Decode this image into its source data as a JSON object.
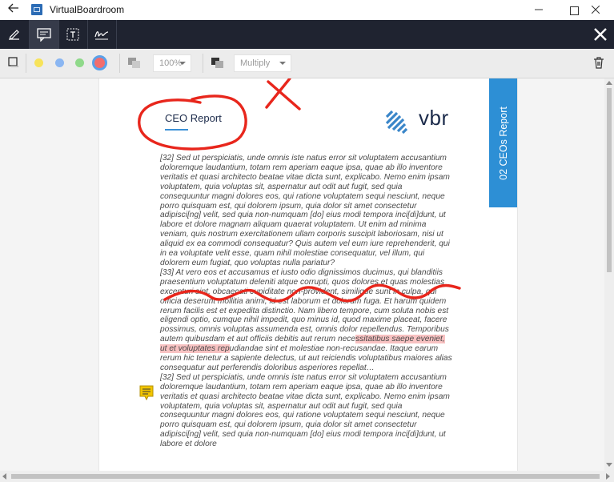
{
  "window": {
    "title": "VirtualBoardroom",
    "back_icon": "back-arrow-icon",
    "app_icon": "vbr-app-icon",
    "minimize": "minimize-icon",
    "maximize": "maximize-icon",
    "close": "close-icon"
  },
  "toolbar": {
    "tools": [
      {
        "name": "pen-tool",
        "icon": "pen-icon"
      },
      {
        "name": "comment-tool",
        "icon": "comment-icon",
        "active": true
      },
      {
        "name": "text-tool",
        "icon": "text-box-icon"
      },
      {
        "name": "signature-tool",
        "icon": "signature-icon"
      }
    ],
    "close_icon": "close-x-icon"
  },
  "options": {
    "shape_icon": "square-outline-icon",
    "colors": [
      "#f7e35a",
      "#8ab6f2",
      "#8fd98a",
      "#f26d6d"
    ],
    "selected_color": "#f26d6d",
    "opacity_icon": "opacity-icon",
    "opacity_value": "100%",
    "blend_icon": "blend-mode-icon",
    "blend_mode": "Multiply",
    "delete_icon": "trash-icon"
  },
  "document": {
    "title": "CEO Report",
    "logo_text": "vbr",
    "side_tab": "02 CEOs Report",
    "paragraphs": [
      "[32] Sed ut perspiciatis, unde omnis iste natus error sit voluptatem accusantium doloremque laudantium, totam rem aperiam eaque ipsa, quae ab illo inventore veritatis et quasi architecto beatae vitae dicta sunt, explicabo. Nemo enim ipsam voluptatem, quia voluptas sit, aspernatur aut odit aut fugit, sed quia consequuntur magni dolores eos, qui ratione voluptatem sequi nesciunt, neque porro quisquam est, qui dolorem ipsum, quia dolor sit amet consectetur adipisci[ng] velit, sed quia non-numquam [do] eius modi tempora inci[di]dunt, ut labore et dolore magnam aliquam quaerat voluptatem. Ut enim ad minima veniam, quis nostrum exercitationem ullam corporis suscipit laboriosam, nisi ut aliquid ex ea commodi consequatur? Quis autem vel eum iure reprehenderit, qui in ea voluptate velit esse, quam nihil molestiae consequatur, vel illum, qui dolorem eum fugiat, quo voluptas nulla pariatur?",
      "[33] At vero eos et accusamus et iusto odio dignissimos ducimus, qui blanditiis praesentium voluptatum deleniti atque corrupti, quos dolores et quas molestias excepturi sint, obcaecati cupiditate non-provident, similique sunt in culpa, qui officia deserunt mollitia animi, id est laborum et dolorum fuga. Et harum quidem rerum facilis est et expedita distinctio. Nam libero tempore, cum soluta nobis est eligendi optio, cumque nihil impedit, quo minus id, quod maxime placeat, facere possimus, omnis voluptas assumenda est, omnis dolor repellendus. Temporibus autem quibusdam et aut officiis debitis aut rerum nece",
      "[32] Sed ut perspiciatis, unde omnis iste natus error sit voluptatem accusantium doloremque laudantium, totam rem aperiam eaque ipsa, quae ab illo inventore veritatis et quasi architecto beatae vitae dicta sunt, explicabo. Nemo enim ipsam voluptatem, quia voluptas sit, aspernatur aut odit aut fugit, sed quia consequuntur magni dolores eos, qui ratione voluptatem sequi nesciunt, neque porro quisquam est, qui dolorem ipsum, quia dolor sit amet consectetur adipisci[ng] velit, sed quia non-numquam [do] eius modi tempora inci[di]dunt, ut labore et dolore"
    ],
    "highlight": "ssitatibus saepe eveniet, ut et voluptates rep",
    "after_highlight": "udiandae sint et molestiae non-recusandae. Itaque earum rerum hic tenetur a sapiente delectus, ut aut reiciendis voluptatibus maiores alias consequatur aut perferendis doloribus asperiores repellat…",
    "note_icon": "sticky-note-icon"
  },
  "annotation_color": "#e8261c"
}
